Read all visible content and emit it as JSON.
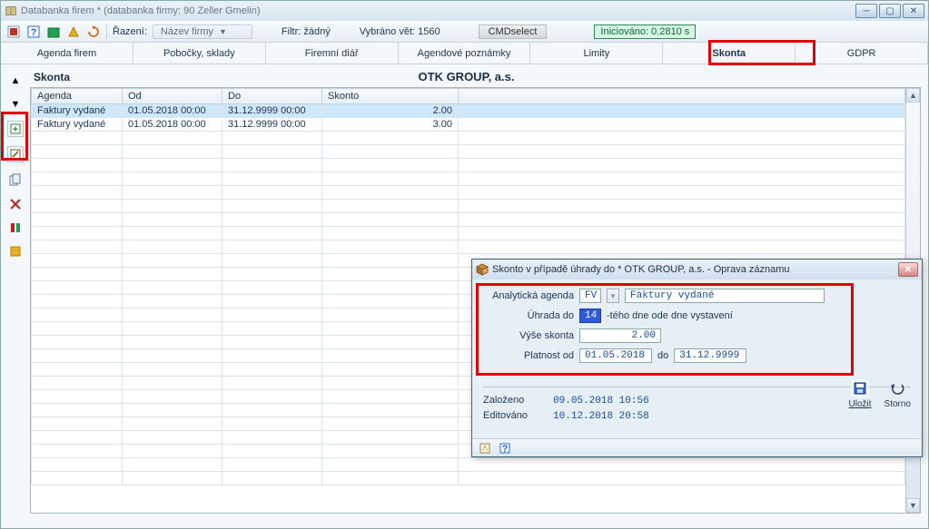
{
  "window_title": "Databanka firem * (databanka firmy: 90 Zeller Gmelin)",
  "toolbar": {
    "sort_label": "Řazení:",
    "sort_value": "Název firmy",
    "filter_label": "Filtr: žádný",
    "selected_label": "Vybráno vět: 1560",
    "cmd_label": "CMDselect",
    "status": "Iniciováno: 0.2810 s"
  },
  "tabs": [
    "Agenda firem",
    "Pobočky, sklady",
    "Firemní diář",
    "Agendové poznámky",
    "Limity",
    "Skonta",
    "GDPR"
  ],
  "panel": {
    "title": "Skonta",
    "company": "OTK GROUP, a.s.",
    "columns": [
      "Agenda",
      "Od",
      "Do",
      "Skonto"
    ],
    "rows": [
      {
        "agenda": "Faktury vydané",
        "od": "01.05.2018 00:00",
        "do": "31.12.9999 00:00",
        "skonto": "2.00"
      },
      {
        "agenda": "Faktury vydané",
        "od": "01.05.2018 00:00",
        "do": "31.12.9999 00:00",
        "skonto": "3.00"
      }
    ]
  },
  "modal": {
    "title": "Skonto v případě úhrady do * OTK GROUP, a.s. - Oprava záznamu",
    "agenda_label": "Analytická agenda",
    "agenda_code": "FV",
    "agenda_name": "Faktury vydané",
    "due_label": "Úhrada do",
    "due_value": "14",
    "due_suffix": "-tého dne ode dne vystavení",
    "amount_label": "Výše skonta",
    "amount_value": "2.00",
    "valid_label": "Platnost od",
    "valid_from": "01.05.2018",
    "valid_to_label": "do",
    "valid_to": "31.12.9999",
    "created_label": "Založeno",
    "created_value": "09.05.2018 10:56",
    "edited_label": "Editováno",
    "edited_value": "10.12.2018 20:58",
    "save_label": "Uložit",
    "cancel_label": "Storno"
  }
}
